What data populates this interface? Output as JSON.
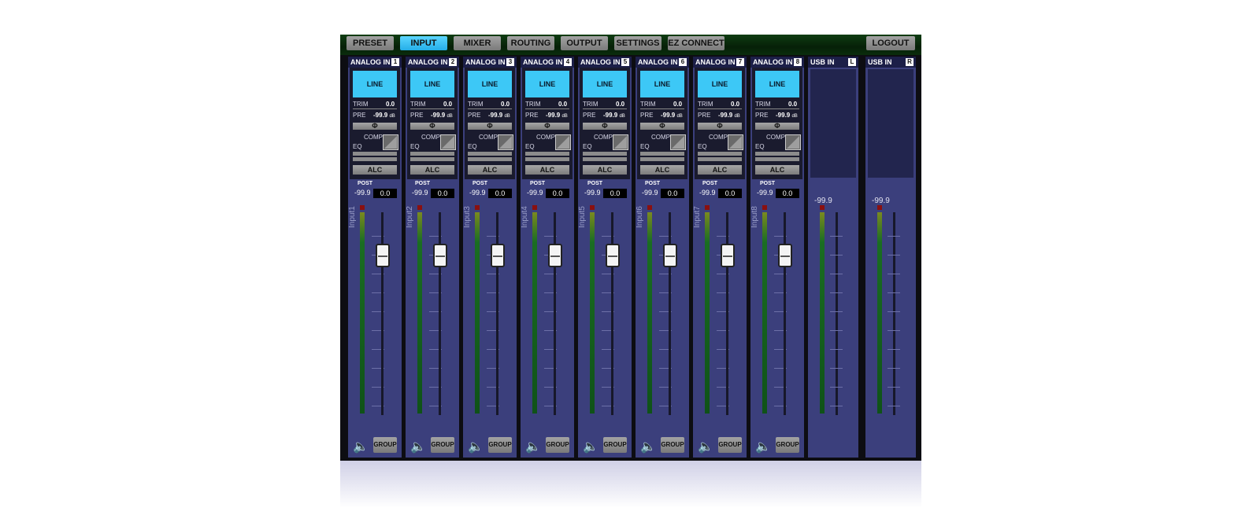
{
  "tabs": [
    "PRESET",
    "INPUT",
    "MIXER",
    "ROUTING",
    "OUTPUT",
    "SETTINGS",
    "EZ CONNECT"
  ],
  "active_tab": "INPUT",
  "logout_label": "LOGOUT",
  "analog_strips": [
    {
      "header": "ANALOG IN",
      "num": "1",
      "line": "LINE",
      "trim_label": "TRIM",
      "trim": "0.0",
      "pre_label": "PRE",
      "pre": "-99.9",
      "unit": "dB",
      "phase": "Φ",
      "comp": "COMP",
      "eq": "EQ",
      "alc": "ALC",
      "post_label": "POST",
      "post_level": "-99.9",
      "post_value": "0.0",
      "name": "Input1",
      "group": "GROUP"
    },
    {
      "header": "ANALOG IN",
      "num": "2",
      "line": "LINE",
      "trim_label": "TRIM",
      "trim": "0.0",
      "pre_label": "PRE",
      "pre": "-99.9",
      "unit": "dB",
      "phase": "Φ",
      "comp": "COMP",
      "eq": "EQ",
      "alc": "ALC",
      "post_label": "POST",
      "post_level": "-99.9",
      "post_value": "0.0",
      "name": "Input2",
      "group": "GROUP"
    },
    {
      "header": "ANALOG IN",
      "num": "3",
      "line": "LINE",
      "trim_label": "TRIM",
      "trim": "0.0",
      "pre_label": "PRE",
      "pre": "-99.9",
      "unit": "dB",
      "phase": "Φ",
      "comp": "COMP",
      "eq": "EQ",
      "alc": "ALC",
      "post_label": "POST",
      "post_level": "-99.9",
      "post_value": "0.0",
      "name": "Input3",
      "group": "GROUP"
    },
    {
      "header": "ANALOG IN",
      "num": "4",
      "line": "LINE",
      "trim_label": "TRIM",
      "trim": "0.0",
      "pre_label": "PRE",
      "pre": "-99.9",
      "unit": "dB",
      "phase": "Φ",
      "comp": "COMP",
      "eq": "EQ",
      "alc": "ALC",
      "post_label": "POST",
      "post_level": "-99.9",
      "post_value": "0.0",
      "name": "Input4",
      "group": "GROUP"
    },
    {
      "header": "ANALOG IN",
      "num": "5",
      "line": "LINE",
      "trim_label": "TRIM",
      "trim": "0.0",
      "pre_label": "PRE",
      "pre": "-99.9",
      "unit": "dB",
      "phase": "Φ",
      "comp": "COMP",
      "eq": "EQ",
      "alc": "ALC",
      "post_label": "POST",
      "post_level": "-99.9",
      "post_value": "0.0",
      "name": "Input5",
      "group": "GROUP"
    },
    {
      "header": "ANALOG IN",
      "num": "6",
      "line": "LINE",
      "trim_label": "TRIM",
      "trim": "0.0",
      "pre_label": "PRE",
      "pre": "-99.9",
      "unit": "dB",
      "phase": "Φ",
      "comp": "COMP",
      "eq": "EQ",
      "alc": "ALC",
      "post_label": "POST",
      "post_level": "-99.9",
      "post_value": "0.0",
      "name": "Input6",
      "group": "GROUP"
    },
    {
      "header": "ANALOG IN",
      "num": "7",
      "line": "LINE",
      "trim_label": "TRIM",
      "trim": "0.0",
      "pre_label": "PRE",
      "pre": "-99.9",
      "unit": "dB",
      "phase": "Φ",
      "comp": "COMP",
      "eq": "EQ",
      "alc": "ALC",
      "post_label": "POST",
      "post_level": "-99.9",
      "post_value": "0.0",
      "name": "Input7",
      "group": "GROUP"
    },
    {
      "header": "ANALOG IN",
      "num": "8",
      "line": "LINE",
      "trim_label": "TRIM",
      "trim": "0.0",
      "pre_label": "PRE",
      "pre": "-99.9",
      "unit": "dB",
      "phase": "Φ",
      "comp": "COMP",
      "eq": "EQ",
      "alc": "ALC",
      "post_label": "POST",
      "post_level": "-99.9",
      "post_value": "0.0",
      "name": "Input8",
      "group": "GROUP"
    }
  ],
  "usb_strips": [
    {
      "header": "USB IN",
      "num": "L",
      "level": "-99.9"
    },
    {
      "header": "USB IN",
      "num": "R",
      "level": "-99.9"
    }
  ],
  "colors": {
    "accent": "#3dc8f6",
    "strip_bg": "#3b3f7c",
    "topbar": "#062008"
  }
}
